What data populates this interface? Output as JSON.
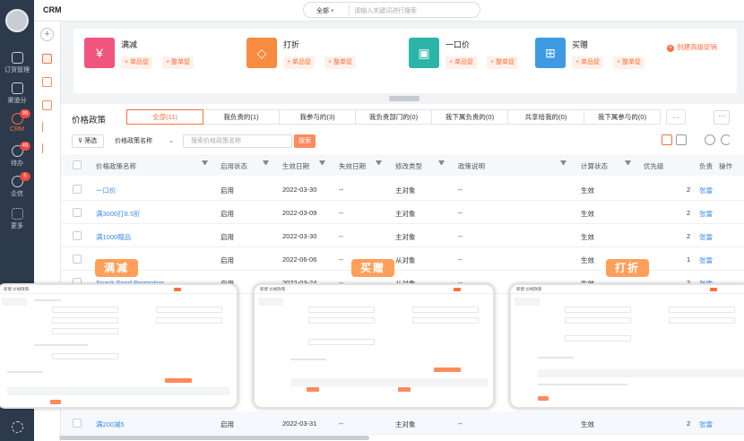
{
  "app": {
    "title": "CRM"
  },
  "search": {
    "scope": "全部",
    "placeholder": "请输入关键词进行搜索"
  },
  "nav": {
    "items": [
      {
        "label": "订货管理",
        "icon": "cube-icon",
        "badge": ""
      },
      {
        "label": "渠道分",
        "icon": "cube-icon",
        "badge": ""
      },
      {
        "label": "CRM",
        "icon": "crm-icon",
        "badge": "99"
      },
      {
        "label": "待办",
        "icon": "check-circle-icon",
        "badge": "49"
      },
      {
        "label": "企信",
        "icon": "chat-icon",
        "badge": "5"
      },
      {
        "label": "更多",
        "icon": "grid-icon",
        "badge": ""
      }
    ]
  },
  "promo": {
    "cards": [
      {
        "name": "满减",
        "icon": "yen-icon",
        "color": "#f0557e",
        "btn1": "+ 单品促",
        "btn2": "+ 整单促"
      },
      {
        "name": "打折",
        "icon": "tag-icon",
        "color": "#f78b3e",
        "btn1": "+ 单品促",
        "btn2": "+ 整单促"
      },
      {
        "name": "一口价",
        "icon": "calendar-icon",
        "color": "#2ab5a8",
        "btn1": "+ 单品促",
        "btn2": "+ 整单促"
      },
      {
        "name": "买赠",
        "icon": "gift-icon",
        "color": "#3e9be3",
        "btn1": "+ 单品促",
        "btn2": "+ 整单促"
      }
    ],
    "create_label": "创建高级促销"
  },
  "list": {
    "title": "价格政策",
    "tabs": [
      "全部(11)",
      "我负责的(1)",
      "我参与的(3)",
      "我负责部门的(0)",
      "我下属负责的(0)",
      "共享给我的(0)",
      "我下属参与的(0)",
      "···"
    ],
    "active_tab": 0,
    "more_label": "···",
    "filter_label": "筛选",
    "field_select": "价格政策名称",
    "search_placeholder": "搜索价格政策名称",
    "search_btn": "搜索"
  },
  "table": {
    "columns": [
      "价格政策名称",
      "启用状态",
      "生效日期",
      "失效日期",
      "修改类型",
      "政策说明",
      "计算状态",
      "优先级",
      "负责",
      "操作"
    ],
    "rows": [
      {
        "name": "一口价",
        "status": "启用",
        "start": "2022-03-30",
        "end": "--",
        "type": "主对象",
        "desc": "--",
        "calc": "生效",
        "priority": "2",
        "owner": "张雷"
      },
      {
        "name": "满3000打8.5折",
        "status": "启用",
        "start": "2022-03-09",
        "end": "--",
        "type": "主对象",
        "desc": "--",
        "calc": "生效",
        "priority": "2",
        "owner": "张雷"
      },
      {
        "name": "满1000赠品",
        "status": "启用",
        "start": "2022-03-30",
        "end": "--",
        "type": "主对象",
        "desc": "--",
        "calc": "生效",
        "priority": "2",
        "owner": "张雷"
      },
      {
        "name": "",
        "status": "启用",
        "start": "2022-06-06",
        "end": "--",
        "type": "从对象",
        "desc": "--",
        "calc": "生效",
        "priority": "1",
        "owner": "张雷"
      },
      {
        "name": "Snack Food Promotion",
        "status": "启用",
        "start": "2022-03-24",
        "end": "--",
        "type": "从对象",
        "desc": "--",
        "calc": "生效",
        "priority": "2",
        "owner": "张雷"
      }
    ],
    "last_row": {
      "name": "满200减5",
      "status": "启用",
      "start": "2022-03-31",
      "end": "--",
      "type": "主对象",
      "desc": "--",
      "calc": "生效",
      "priority": "2",
      "owner": "张雷"
    }
  },
  "previews": [
    {
      "label": "满减",
      "caption": "新建 价格政策"
    },
    {
      "label": "买赠",
      "caption": "新建 价格政策"
    },
    {
      "label": "打折",
      "caption": "新建 价格政策"
    }
  ]
}
